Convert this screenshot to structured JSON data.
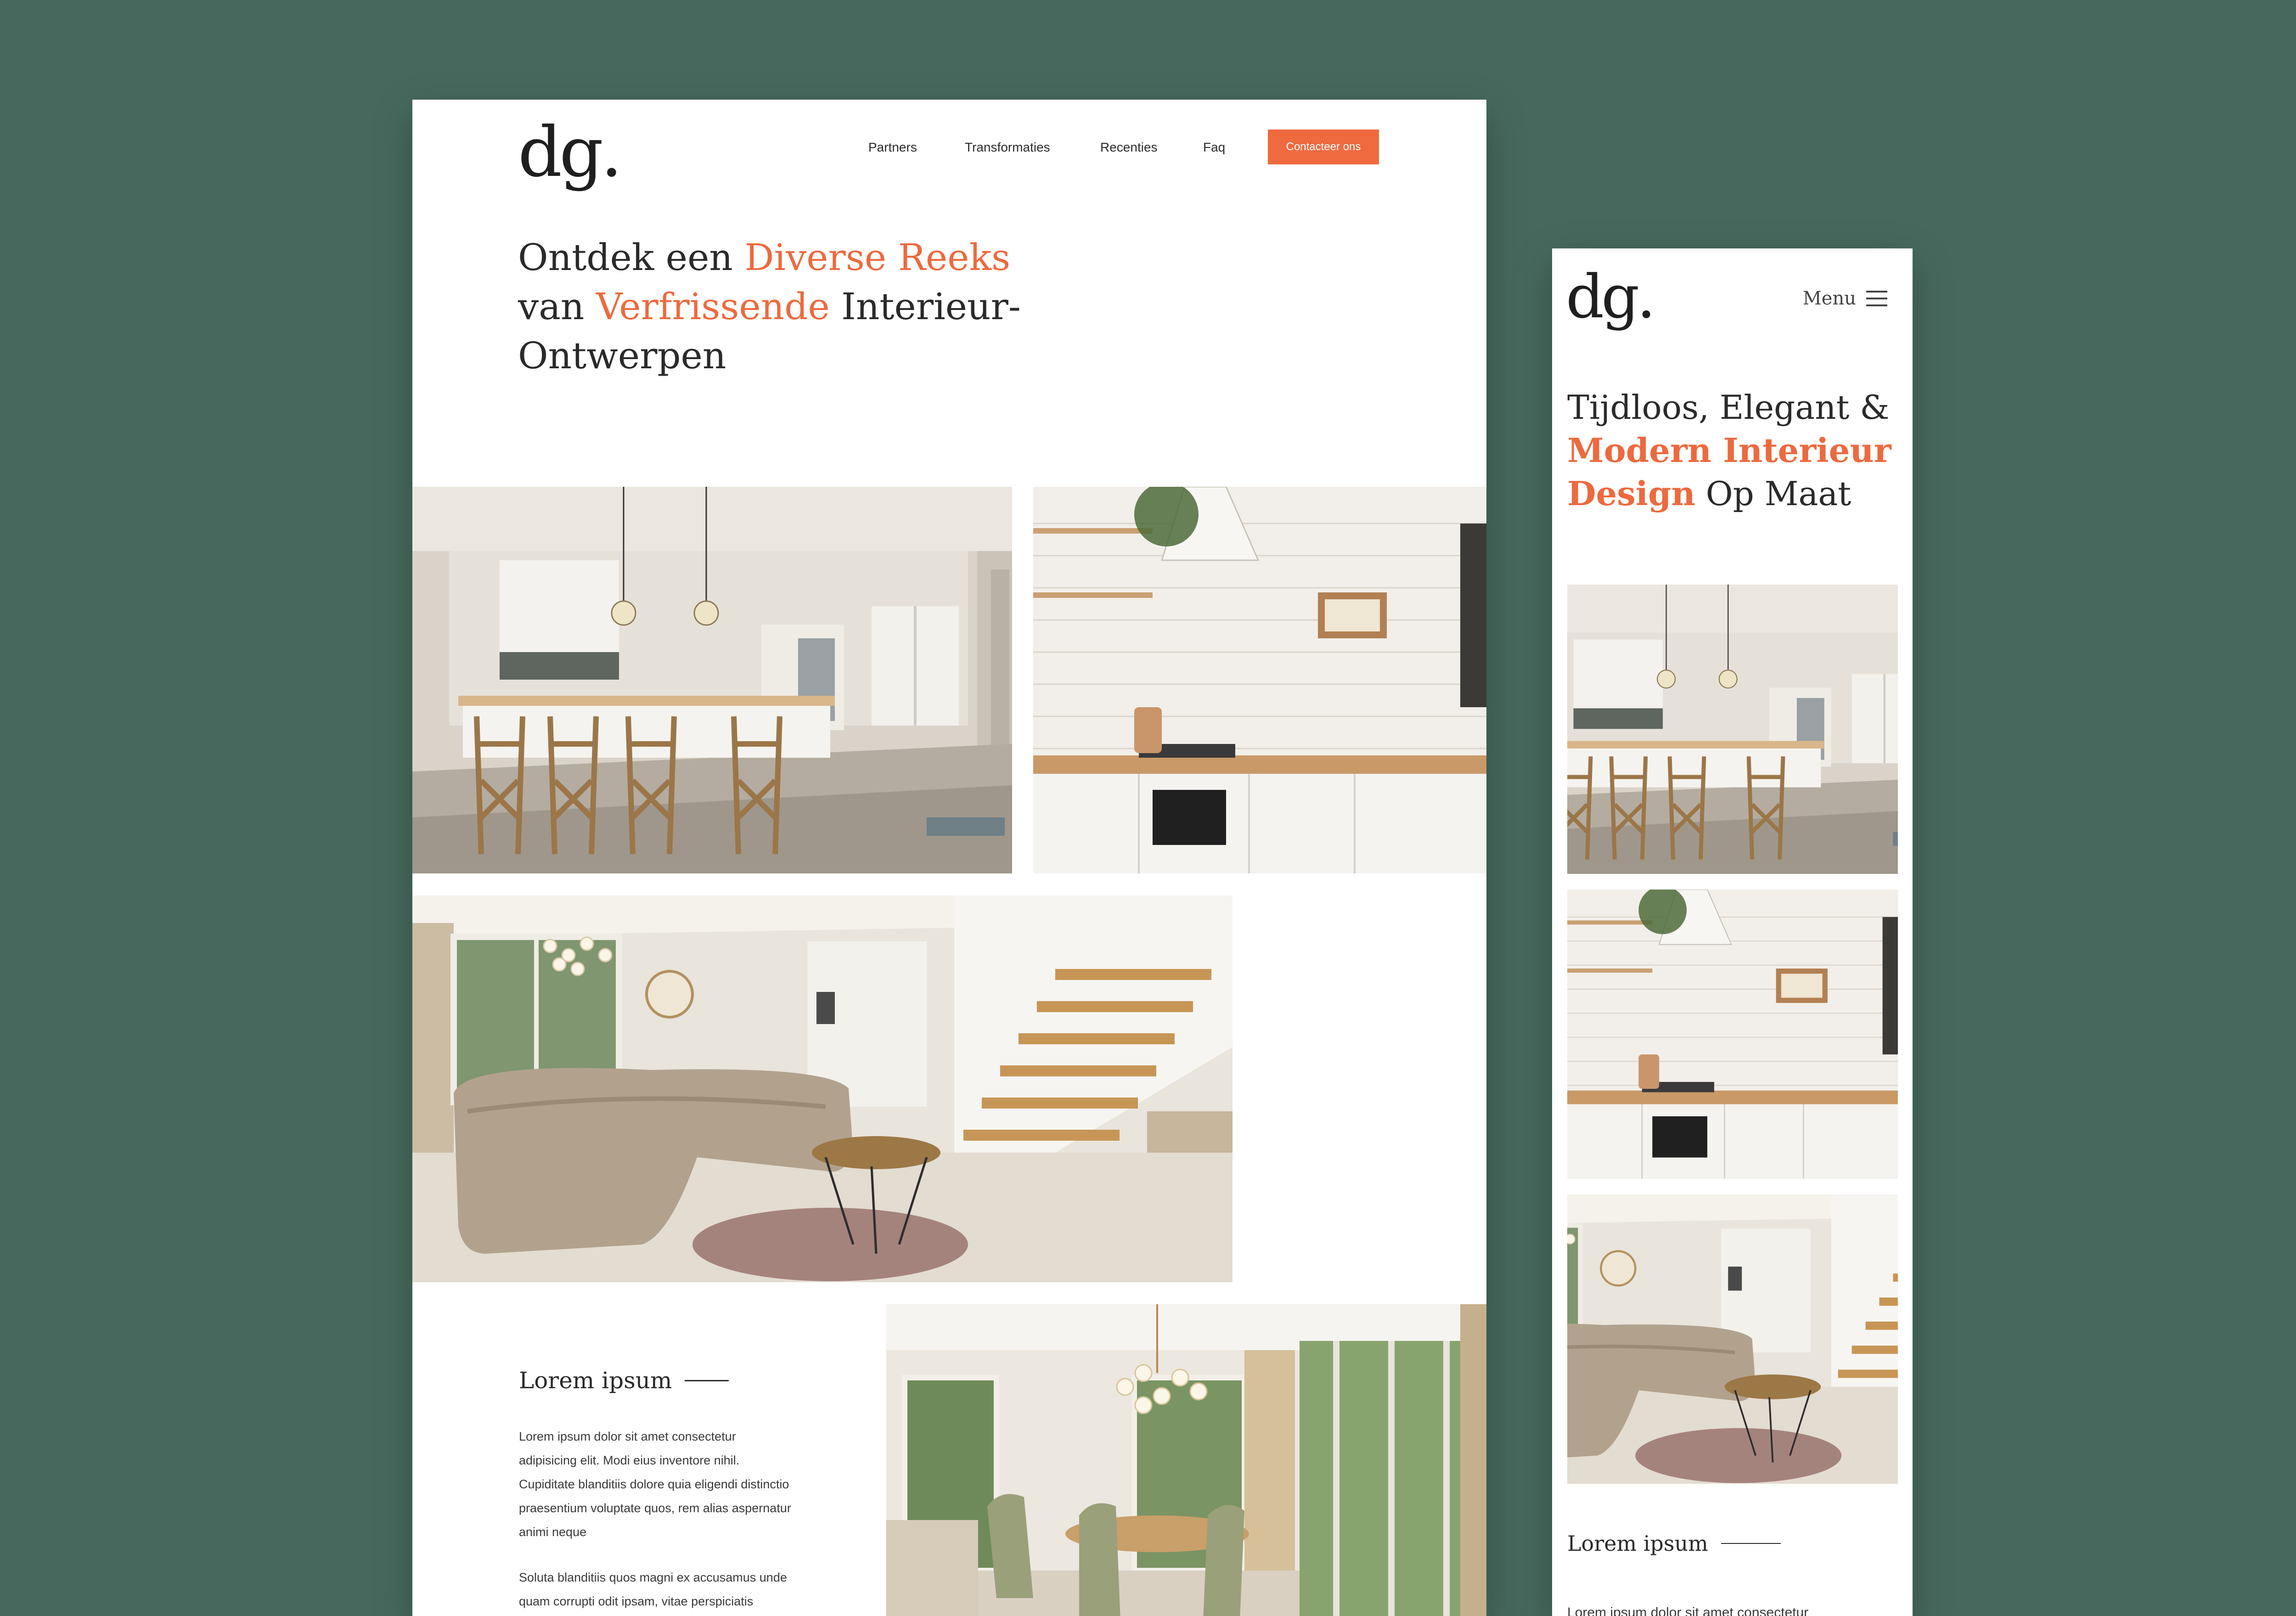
{
  "colors": {
    "background": "#47695d",
    "accent": "#ec6a3f",
    "text": "#2a2a2a"
  },
  "desktop": {
    "logo": "dg.",
    "nav": {
      "links": [
        "Partners",
        "Transformaties",
        "Recenties",
        "Faq"
      ],
      "cta": "Contacteer ons"
    },
    "hero": {
      "part1": "Ontdek een ",
      "accent1": "Diverse Reeks",
      "part2": "van ",
      "accent2": "Verfrissende",
      "part3": " Interieur-",
      "part4": "Ontwerpen"
    },
    "photos": [
      "kitchen-with-island",
      "white-brick-kitchen",
      "living-room-with-staircase",
      "dining-room"
    ],
    "section": {
      "title": "Lorem ipsum",
      "paragraph1": "Lorem ipsum dolor sit amet consectetur adipisicing elit. Modi eius inventore nihil. Cupiditate blanditiis dolore quia eligendi distinctio praesentium voluptate quos, rem alias aspernatur animi neque",
      "paragraph2": "Soluta blanditiis quos magni ex accusamus unde quam corrupti odit ipsam, vitae perspiciatis similique aperiam!"
    }
  },
  "mobile": {
    "logo": "dg.",
    "menu_label": "Menu",
    "hero": {
      "part1": "Tijdloos, Elegant &",
      "accent1": "Modern Interieur",
      "accent2": "Design",
      "part2": " Op Maat"
    },
    "photos": [
      "kitchen-with-island",
      "white-brick-kitchen",
      "living-room-with-staircase"
    ],
    "section": {
      "title": "Lorem ipsum",
      "paragraph": "Lorem ipsum dolor sit amet consectetur"
    }
  }
}
